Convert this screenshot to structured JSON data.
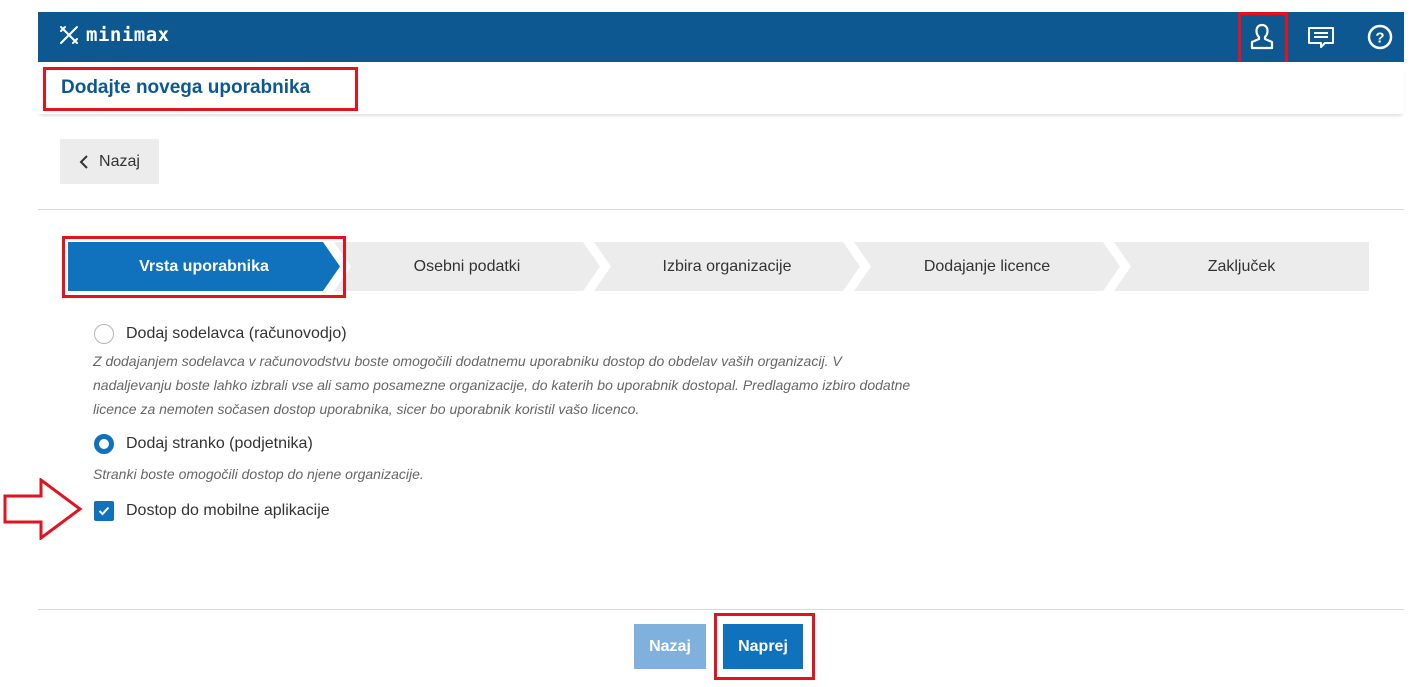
{
  "app": {
    "logo_text": "minimax"
  },
  "header_icons": [
    "user-icon",
    "message-icon",
    "help-icon"
  ],
  "page": {
    "title": "Dodajte novega uporabnika"
  },
  "back_button": {
    "label": "Nazaj"
  },
  "steps": [
    {
      "label": "Vrsta uporabnika",
      "active": true
    },
    {
      "label": "Osebni podatki",
      "active": false
    },
    {
      "label": "Izbira organizacije",
      "active": false
    },
    {
      "label": "Dodajanje licence",
      "active": false
    },
    {
      "label": "Zaključek",
      "active": false
    }
  ],
  "options": {
    "accountant": {
      "label": "Dodaj sodelavca (računovodjo)",
      "selected": false,
      "description": "Z dodajanjem sodelavca v računovodstvu boste omogočili dodatnemu uporabniku dostop do obdelav vaših organizacij. V nadaljevanju boste lahko izbrali vse ali samo posamezne organizacije, do katerih bo uporabnik dostopal. Predlagamo izbiro dodatne licence za nemoten sočasen dostop uporabnika, sicer bo uporabnik koristil vašo licenco."
    },
    "client": {
      "label": "Dodaj stranko (podjetnika)",
      "selected": true,
      "description": "Stranki boste omogočili dostop do njene organizacije."
    },
    "mobile_access": {
      "label": "Dostop do mobilne aplikacije",
      "checked": true
    }
  },
  "footer": {
    "back_label": "Nazaj",
    "next_label": "Naprej"
  },
  "colors": {
    "brand": "#0d5891",
    "primary": "#1072bd",
    "primary_disabled": "#7fb1dc",
    "highlight": "#e0141e",
    "step_inactive": "#ececec"
  }
}
